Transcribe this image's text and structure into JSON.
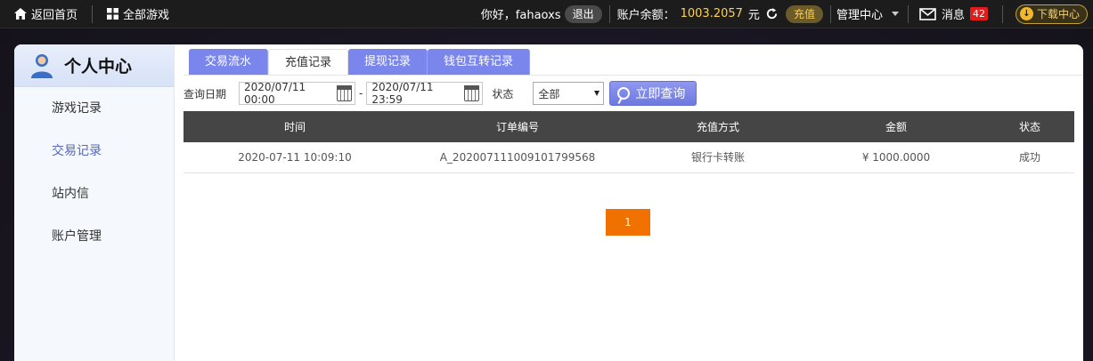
{
  "topbar": {
    "home_label": "返回首页",
    "all_games_label": "全部游戏",
    "greeting": "你好，fahaoxs",
    "logout_label": "退出",
    "balance_label": "账户余额：",
    "balance_value": "1003.2057",
    "balance_unit": "元",
    "recharge_label": "充值",
    "manage_label": "管理中心",
    "messages_label": "消息",
    "messages_count": "42",
    "download_label": "下载中心"
  },
  "sidebar": {
    "title": "个人中心",
    "items": [
      {
        "label": "游戏记录"
      },
      {
        "label": "交易记录"
      },
      {
        "label": "站内信"
      },
      {
        "label": "账户管理"
      }
    ]
  },
  "tabs": [
    {
      "label": "交易流水"
    },
    {
      "label": "充值记录"
    },
    {
      "label": "提现记录"
    },
    {
      "label": "钱包互转记录"
    }
  ],
  "filters": {
    "date_label": "查询日期",
    "date_from": "2020/07/11 00:00",
    "date_to": "2020/07/11 23:59",
    "status_label": "状态",
    "status_value": "全部",
    "query_label": "立即查询"
  },
  "table": {
    "headers": [
      "时间",
      "订单编号",
      "充值方式",
      "金额",
      "状态"
    ],
    "rows": [
      [
        "2020-07-11 10:09:10",
        "A_202007111009101799568",
        "银行卡转账",
        "¥ 1000.0000",
        "成功"
      ]
    ]
  },
  "pagination": {
    "current": "1"
  },
  "colors": {
    "tab": "#7b86ec",
    "accent": "#f07000",
    "header_bg": "#454545"
  }
}
